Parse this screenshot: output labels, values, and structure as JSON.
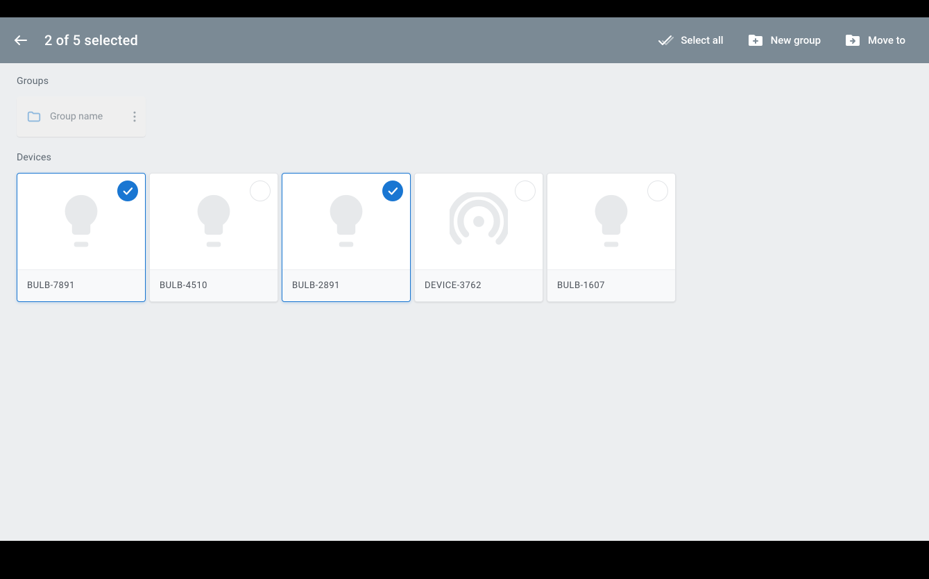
{
  "colors": {
    "accent": "#1976d2",
    "appbar": "#7b8a95",
    "bg": "#eceef0"
  },
  "header": {
    "title": "2 of 5 selected",
    "actions": {
      "select_all": "Select all",
      "new_group": "New group",
      "move_to": "Move to"
    }
  },
  "sections": {
    "groups_label": "Groups",
    "devices_label": "Devices"
  },
  "groups": [
    {
      "name": "Group name"
    }
  ],
  "devices": [
    {
      "name": "BULB-7891",
      "type": "bulb",
      "selected": true
    },
    {
      "name": "BULB-4510",
      "type": "bulb",
      "selected": false
    },
    {
      "name": "BULB-2891",
      "type": "bulb",
      "selected": true
    },
    {
      "name": "DEVICE-3762",
      "type": "antenna",
      "selected": false
    },
    {
      "name": "BULB-1607",
      "type": "bulb",
      "selected": false
    }
  ]
}
